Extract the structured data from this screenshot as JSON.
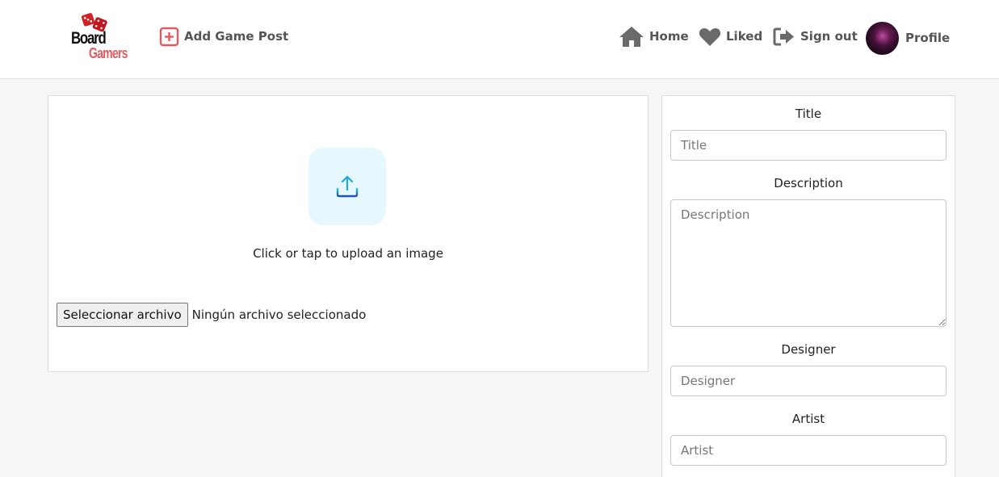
{
  "header": {
    "logo": {
      "line1": "Board",
      "line2": "Gamers"
    },
    "add_post": {
      "label": "Add Game Post",
      "icon": "plus-square-icon"
    },
    "nav": [
      {
        "label": "Home",
        "icon": "home-icon"
      },
      {
        "label": "Liked",
        "icon": "heart-icon"
      },
      {
        "label": "Sign out",
        "icon": "sign-out-icon"
      },
      {
        "label": "Profile",
        "icon": "avatar"
      }
    ]
  },
  "upload": {
    "icon": "upload-icon",
    "prompt": "Click or tap to upload an image",
    "file_button": "Seleccionar archivo",
    "file_status": "Ningún archivo seleccionado"
  },
  "form": {
    "title": {
      "label": "Title",
      "placeholder": "Title",
      "value": ""
    },
    "description": {
      "label": "Description",
      "placeholder": "Description",
      "value": ""
    },
    "designer": {
      "label": "Designer",
      "placeholder": "Designer",
      "value": ""
    },
    "artist": {
      "label": "Artist",
      "placeholder": "Artist",
      "value": ""
    }
  },
  "colors": {
    "accent": "#e35a60",
    "nav_text": "#555555",
    "upload_bg": "#e6f8fd",
    "page_bg": "#f6f6f6"
  }
}
